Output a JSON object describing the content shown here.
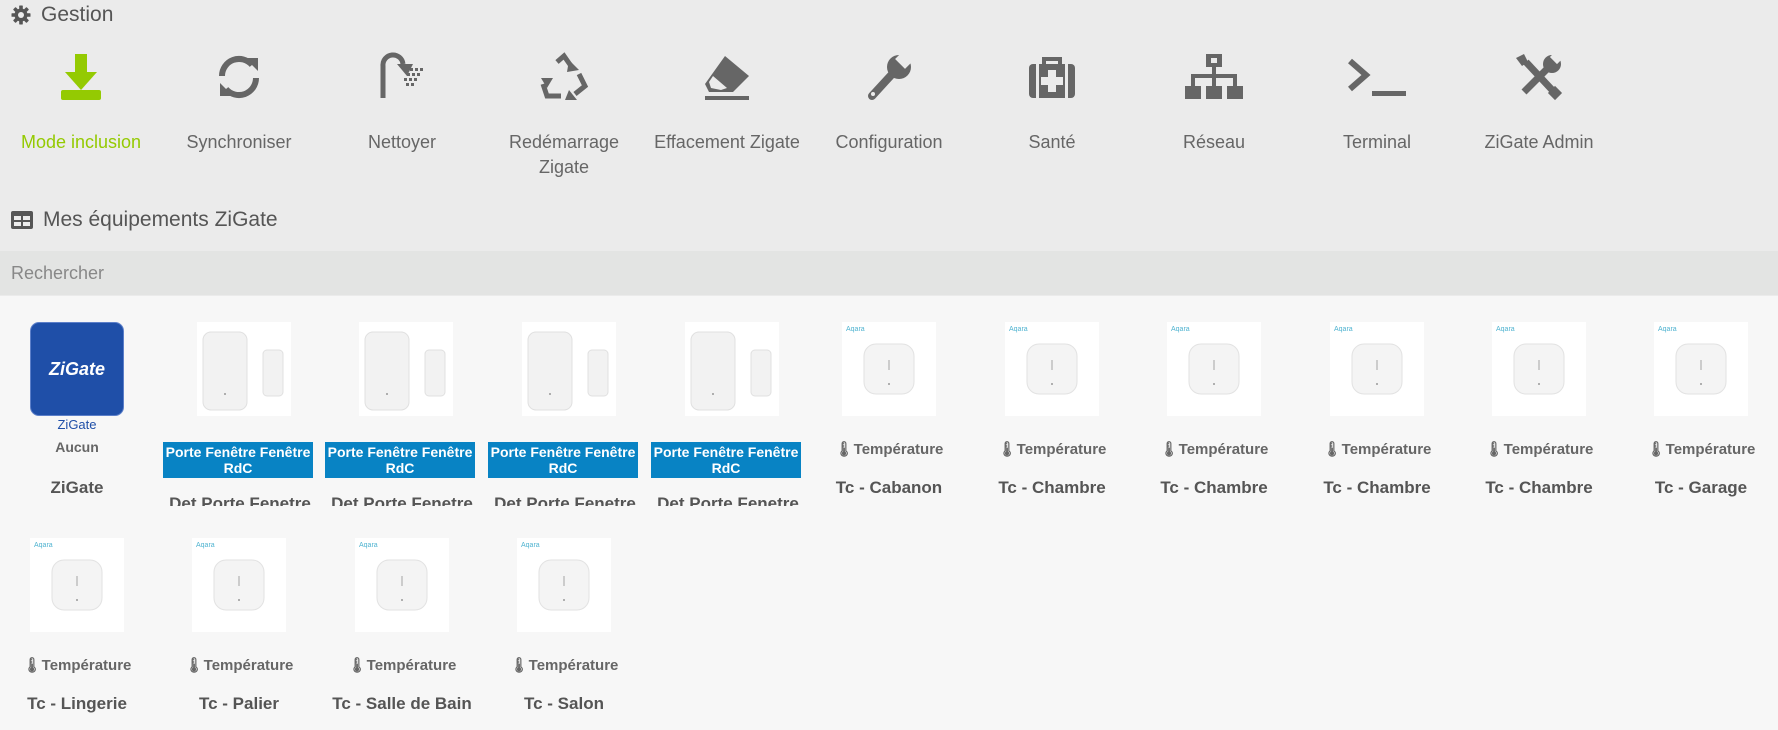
{
  "sections": {
    "gestion": "Gestion",
    "equipements": "Mes équipements ZiGate"
  },
  "accent_color": "#94ca02",
  "object_badge_color": "#0883c4",
  "actions": [
    {
      "label": "Mode inclusion",
      "icon": "download-icon"
    },
    {
      "label": "Synchroniser",
      "icon": "sync-icon"
    },
    {
      "label": "Nettoyer",
      "icon": "shower-icon"
    },
    {
      "label": "Redémarrage Zigate",
      "icon": "recycle-icon"
    },
    {
      "label": "Effacement Zigate",
      "icon": "eraser-icon"
    },
    {
      "label": "Configuration",
      "icon": "wrench-icon"
    },
    {
      "label": "Santé",
      "icon": "medkit-icon"
    },
    {
      "label": "Réseau",
      "icon": "network-icon"
    },
    {
      "label": "Terminal",
      "icon": "terminal-icon"
    },
    {
      "label": "ZiGate Admin",
      "icon": "tools-icon"
    }
  ],
  "search": {
    "placeholder": "Rechercher"
  },
  "zigate_card": {
    "logo_text": "ZiGate",
    "subtitle": "ZiGate",
    "protocol": "Aucun",
    "name": "ZiGate"
  },
  "door_devices": [
    {
      "object": "Porte Fenêtre Fenêtre RdC",
      "name": "Det Porte Fenetre"
    },
    {
      "object": "Porte Fenêtre Fenêtre RdC",
      "name": "Det Porte Fenetre"
    },
    {
      "object": "Porte Fenêtre Fenêtre RdC",
      "name": "Det Porte Fenetre"
    },
    {
      "object": "Porte Fenêtre Fenêtre RdC",
      "name": "Det Porte Fenetre"
    }
  ],
  "temp_devices": [
    {
      "badge": "Température",
      "name": "Tc - Cabanon"
    },
    {
      "badge": "Température",
      "name": "Tc - Chambre"
    },
    {
      "badge": "Température",
      "name": "Tc - Chambre"
    },
    {
      "badge": "Température",
      "name": "Tc - Chambre"
    },
    {
      "badge": "Température",
      "name": "Tc - Chambre"
    },
    {
      "badge": "Température",
      "name": "Tc - Garage"
    },
    {
      "badge": "Température",
      "name": "Tc - Lingerie"
    },
    {
      "badge": "Température",
      "name": "Tc - Palier"
    },
    {
      "badge": "Température",
      "name": "Tc - Salle de Bain"
    },
    {
      "badge": "Température",
      "name": "Tc - Salon"
    }
  ],
  "brand_text": "Aqara"
}
